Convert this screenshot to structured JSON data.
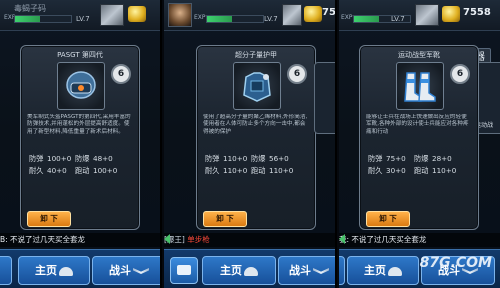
{
  "panels": [
    {
      "player_name": "毒蝎子码",
      "exp_label": "EXP",
      "exp_fraction": 0.45,
      "level": "LV.7",
      "gold": "",
      "card": {
        "title": "PASGT 第四代",
        "badge": "6",
        "description": "美军制式头盔PASGT的第四代,采用丰富的防弹技术,并用蓬松的外层提高舒适度。使用了新型材料,降低重量了新术后材料。",
        "stats": [
          {
            "l1": "防弹",
            "v1": "100+0",
            "l2": "防爆",
            "v2": "48+0"
          },
          {
            "l1": "耐久",
            "v1": "40+0",
            "l2": "跑动",
            "v2": "100+0"
          }
        ],
        "unequip": "卸 下"
      },
      "chat": "B: 不说了过几天买全套龙",
      "nav_main": "主页",
      "nav_battle": "战斗"
    },
    {
      "player_name": "",
      "exp_label": "EXP",
      "exp_fraction": 0.45,
      "level": "LV.7",
      "gold": "75",
      "card": {
        "title": "超分子量护甲",
        "badge": "6",
        "description": "使用了超高分子量的聚乙烯材料,外形简洁,使用者在人体可防止多个方向一击中,都会得被的保护",
        "stats": [
          {
            "l1": "防弹",
            "v1": "110+0",
            "l2": "防爆",
            "v2": "56+0"
          },
          {
            "l1": "耐久",
            "v1": "110+0",
            "l2": "跑动",
            "v2": "110+0"
          }
        ],
        "unequip": "卸 下"
      },
      "chat_prefix": "[爆王]",
      "chat": "单步枪",
      "nav_main": "主页",
      "nav_battle": "战斗"
    },
    {
      "player_name": "",
      "exp_label": "EXP",
      "exp_fraction": 0.45,
      "level": "LV.7",
      "gold": "7558",
      "side_tab": "武器",
      "side_card_label": "运动战",
      "card": {
        "title": "运动战型军靴",
        "badge": "6",
        "description": "能够让士兵在战场上快速做出反应的轻便军靴,各种外部的设计使士兵能应对各种疼痛和行动",
        "stats": [
          {
            "l1": "防弹",
            "v1": "75+0",
            "l2": "防爆",
            "v2": "28+0"
          },
          {
            "l1": "耐久",
            "v1": "30+0",
            "l2": "跑动",
            "v2": "110+0"
          }
        ],
        "unequip": "卸 下"
      },
      "chat": "我: 不说了过几天买全套龙",
      "nav_main": "主页",
      "nav_battle": "战斗"
    }
  ],
  "watermark": "87G.COM",
  "colors": {
    "accent_orange": "#d97a12",
    "nav_blue": "#17509a",
    "exp_green": "#3dd16e"
  }
}
